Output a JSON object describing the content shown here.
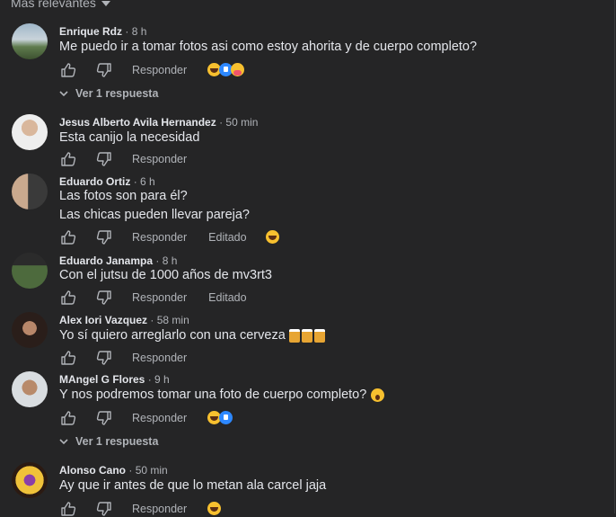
{
  "sort_label": "Más relevantes",
  "actions": {
    "reply": "Responder",
    "edited": "Editado"
  },
  "comments": [
    {
      "name": "Enrique Rdz",
      "time": "8 h",
      "lines": [
        "Me puedo ir a tomar fotos asi como estoy ahorita y de cuerpo completo?"
      ],
      "edited": false,
      "reactions": [
        "haha",
        "like",
        "care"
      ],
      "replies": "Ver 1 respuesta"
    },
    {
      "name": "Jesus Alberto Avila Hernandez",
      "time": "50 min",
      "lines": [
        "Esta canijo la necesidad"
      ],
      "edited": false,
      "reactions": [],
      "replies": ""
    },
    {
      "name": "Eduardo Ortiz",
      "time": "6 h",
      "lines": [
        "Las fotos son para él?",
        "Las chicas pueden llevar pareja?"
      ],
      "edited": true,
      "reactions": [
        "haha"
      ],
      "replies": ""
    },
    {
      "name": "Eduardo Janampa",
      "time": "8 h",
      "lines": [
        "Con el jutsu de 1000 años de mv3rt3"
      ],
      "edited": true,
      "reactions": [],
      "replies": ""
    },
    {
      "name": "Alex Iori Vazquez",
      "time": "58 min",
      "lines": [
        "Yo sí quiero arreglarlo con una cerveza"
      ],
      "edited": false,
      "reactions": [],
      "replies": ""
    },
    {
      "name": "MAngel G Flores",
      "time": "9 h",
      "lines": [
        "Y nos podremos tomar una foto de cuerpo completo?"
      ],
      "edited": false,
      "reactions": [
        "haha",
        "like"
      ],
      "replies": "Ver 1 respuesta"
    },
    {
      "name": "Alonso Cano",
      "time": "50 min",
      "lines": [
        "Ay que ir antes de que lo metan ala carcel jaja"
      ],
      "edited": false,
      "reactions": [
        "haha"
      ],
      "replies": ""
    }
  ]
}
